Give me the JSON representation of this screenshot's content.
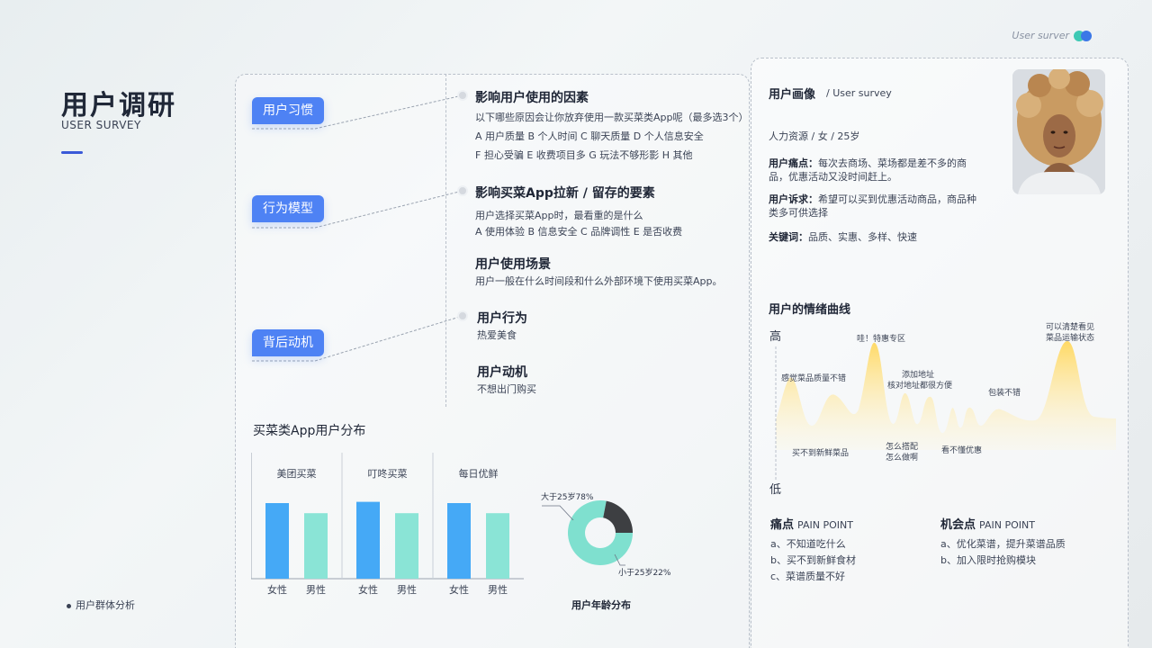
{
  "header": {
    "tag": "User surver",
    "colors": [
      "#3ec9b4",
      "#3b78e7"
    ]
  },
  "title": {
    "main": "用户调研",
    "sub": "USER SURVEY"
  },
  "footer": {
    "note": "用户群体分析"
  },
  "mindmap": {
    "pills": [
      "用户习惯",
      "行为模型",
      "背后动机"
    ],
    "sections": [
      {
        "title": "影响用户使用的因素",
        "lines": [
          "以下哪些原因会让你放弃使用一款买菜类App呢（最多选3个）",
          "A 用户质量   B 个人时间   C 聊天质量   D 个人信息安全",
          "F 担心受骗   E 收费项目多   G 玩法不够形影   H 其他"
        ]
      },
      {
        "title": "影响买菜App拉新 / 留存的要素",
        "lines": [
          "用户选择买菜App时，最看重的是什么",
          "A  使用体验   B 信息安全   C 品牌调性   E 是否收费"
        ]
      },
      {
        "title": "用户使用场景",
        "lines": [
          "用户一般在什么时间段和什么外部环境下使用买菜App。"
        ]
      },
      {
        "title": "用户行为",
        "lines": [
          "热爱美食"
        ]
      },
      {
        "title": "用户动机",
        "lines": [
          "不想出门购买"
        ]
      }
    ]
  },
  "distribution": {
    "title": "买菜类App用户分布",
    "age_title": "用户年龄分布"
  },
  "chart_data": [
    {
      "type": "bar",
      "groups": [
        "美团买菜",
        "叮咚买菜",
        "每日优鲜"
      ],
      "categories": [
        "女性",
        "男性"
      ],
      "series": [
        {
          "values": [
            60,
            52
          ]
        },
        {
          "values": [
            61,
            52
          ]
        },
        {
          "values": [
            60,
            52
          ]
        }
      ],
      "colors": [
        "#45a9f6",
        "#8ae4d6"
      ]
    },
    {
      "type": "pie",
      "labels": [
        "大于25岁78%",
        "小于25岁22%"
      ],
      "values": [
        78,
        22
      ],
      "colors": [
        "#7fe0cf",
        "#3d3f42"
      ]
    }
  ],
  "persona": {
    "title": "用户画像",
    "subtitle": "/ User survey",
    "info": "人力资源 / 女 / 25岁",
    "pain_label": "用户痛点：",
    "pain_text": "每次去商场、菜场都是差不多的商品，优惠活动又没时间赶上。",
    "demand_label": "用户诉求：",
    "demand_text": "希望可以买到优惠活动商品，商品种类多可供选择",
    "keyword_label": "关键词：",
    "keyword_text": "品质、实惠、多样、快速"
  },
  "emotion": {
    "title": "用户的情绪曲线",
    "high": "高",
    "low": "低",
    "labels": [
      "感觉菜品质量不错",
      "买不到新鲜菜品",
      "哇！特惠专区",
      "添加地址",
      "核对地址都很方便",
      "怎么搭配",
      "怎么做啊",
      "看不懂优惠",
      "包装不错",
      "可以清楚看见",
      "菜品运输状态"
    ]
  },
  "points": {
    "pain": {
      "title": "痛点",
      "en": "PAIN POINT",
      "items": [
        "a、不知道吃什么",
        "b、买不到新鲜食材",
        "c、菜谱质量不好"
      ]
    },
    "chance": {
      "title": "机会点",
      "en": "PAIN POINT",
      "items": [
        "a、优化菜谱，提升菜谱品质",
        "b、加入限时抢购模块"
      ]
    }
  }
}
